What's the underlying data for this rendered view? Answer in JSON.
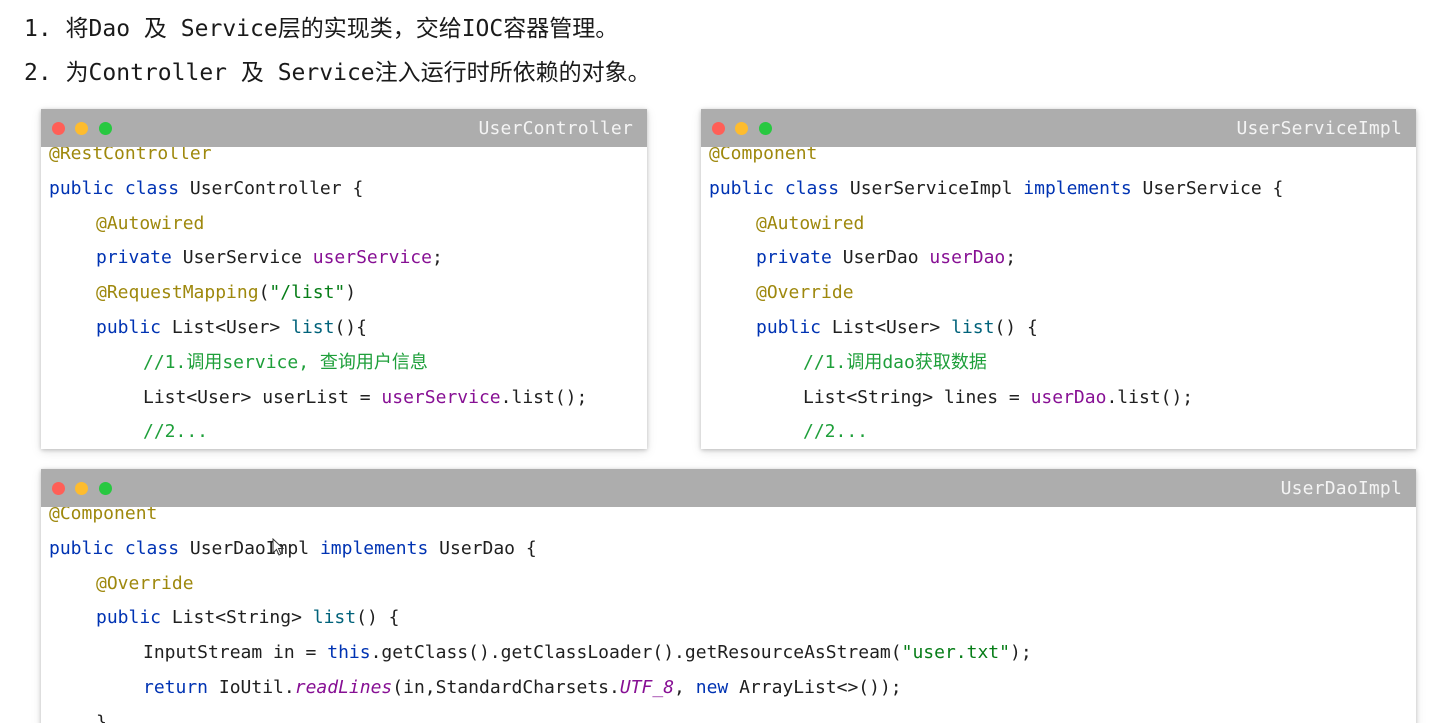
{
  "headings": {
    "line1": "1. 将Dao 及 Service层的实现类，交给IOC容器管理。",
    "line2": "2. 为Controller 及 Service注入运行时所依赖的对象。"
  },
  "colors": {
    "titlebar": "#adadad",
    "keyword": "#0033b3",
    "annotation": "#9e880d",
    "field": "#871094",
    "string": "#067d17",
    "comment": "#1e9f3a"
  },
  "panels": {
    "controller": {
      "title": "UserController",
      "code": {
        "l1_ann": "@RestController",
        "l2_kw": "public class",
        "l2_rest": " UserController {",
        "l3_ann": "@Autowired",
        "l4_kw": "private",
        "l4_type": " UserService ",
        "l4_field": "userService",
        "l4_end": ";",
        "l5_ann": "@RequestMapping",
        "l5_open": "(",
        "l5_str": "\"/list\"",
        "l5_close": ")",
        "l6_kw": "public",
        "l6_type": " List<User> ",
        "l6_fn": "list",
        "l6_end": "(){",
        "l7_comment": "//1.调用service, 查询用户信息",
        "l8_type": "List<User> userList = ",
        "l8_field": "userService",
        "l8_end": ".list();",
        "l9_comment": "//2..."
      }
    },
    "service": {
      "title": "UserServiceImpl",
      "code": {
        "l1_ann": "@Component",
        "l2_kw": "public class",
        "l2_mid": " UserServiceImpl ",
        "l2_kw2": "implements",
        "l2_rest": " UserService {",
        "l3_ann": "@Autowired",
        "l4_kw": "private",
        "l4_type": " UserDao ",
        "l4_field": "userDao",
        "l4_end": ";",
        "l5_ann": "@Override",
        "l6_kw": "public",
        "l6_type": " List<User> ",
        "l6_fn": "list",
        "l6_end": "() {",
        "l7_comment": "//1.调用dao获取数据",
        "l8_type": "List<String> lines = ",
        "l8_field": "userDao",
        "l8_end": ".list();",
        "l9_comment": "//2..."
      }
    },
    "dao": {
      "title": "UserDaoImpl",
      "code": {
        "l1_ann": "@Component",
        "l2_kw": "public class",
        "l2_mid": " UserDaoImpl ",
        "l2_kw2": "implements",
        "l2_rest": " UserDao {",
        "l3_ann": "@Override",
        "l4_kw": "public",
        "l4_type": " List<String> ",
        "l4_fn": "list",
        "l4_end": "() {",
        "l5_type": "InputStream in = ",
        "l5_kw": "this",
        "l5_mid": ".getClass().getClassLoader().getResourceAsStream(",
        "l5_str": "\"user.txt\"",
        "l5_end": ");",
        "l6_kw": "return",
        "l6_a": " IoUtil.",
        "l6_ital": "readLines",
        "l6_b": "(in,StandardCharsets.",
        "l6_ital2": "UTF_8",
        "l6_c": ", ",
        "l6_kw2": "new",
        "l6_d": " ArrayList<>());",
        "l7_end": "}"
      }
    }
  }
}
